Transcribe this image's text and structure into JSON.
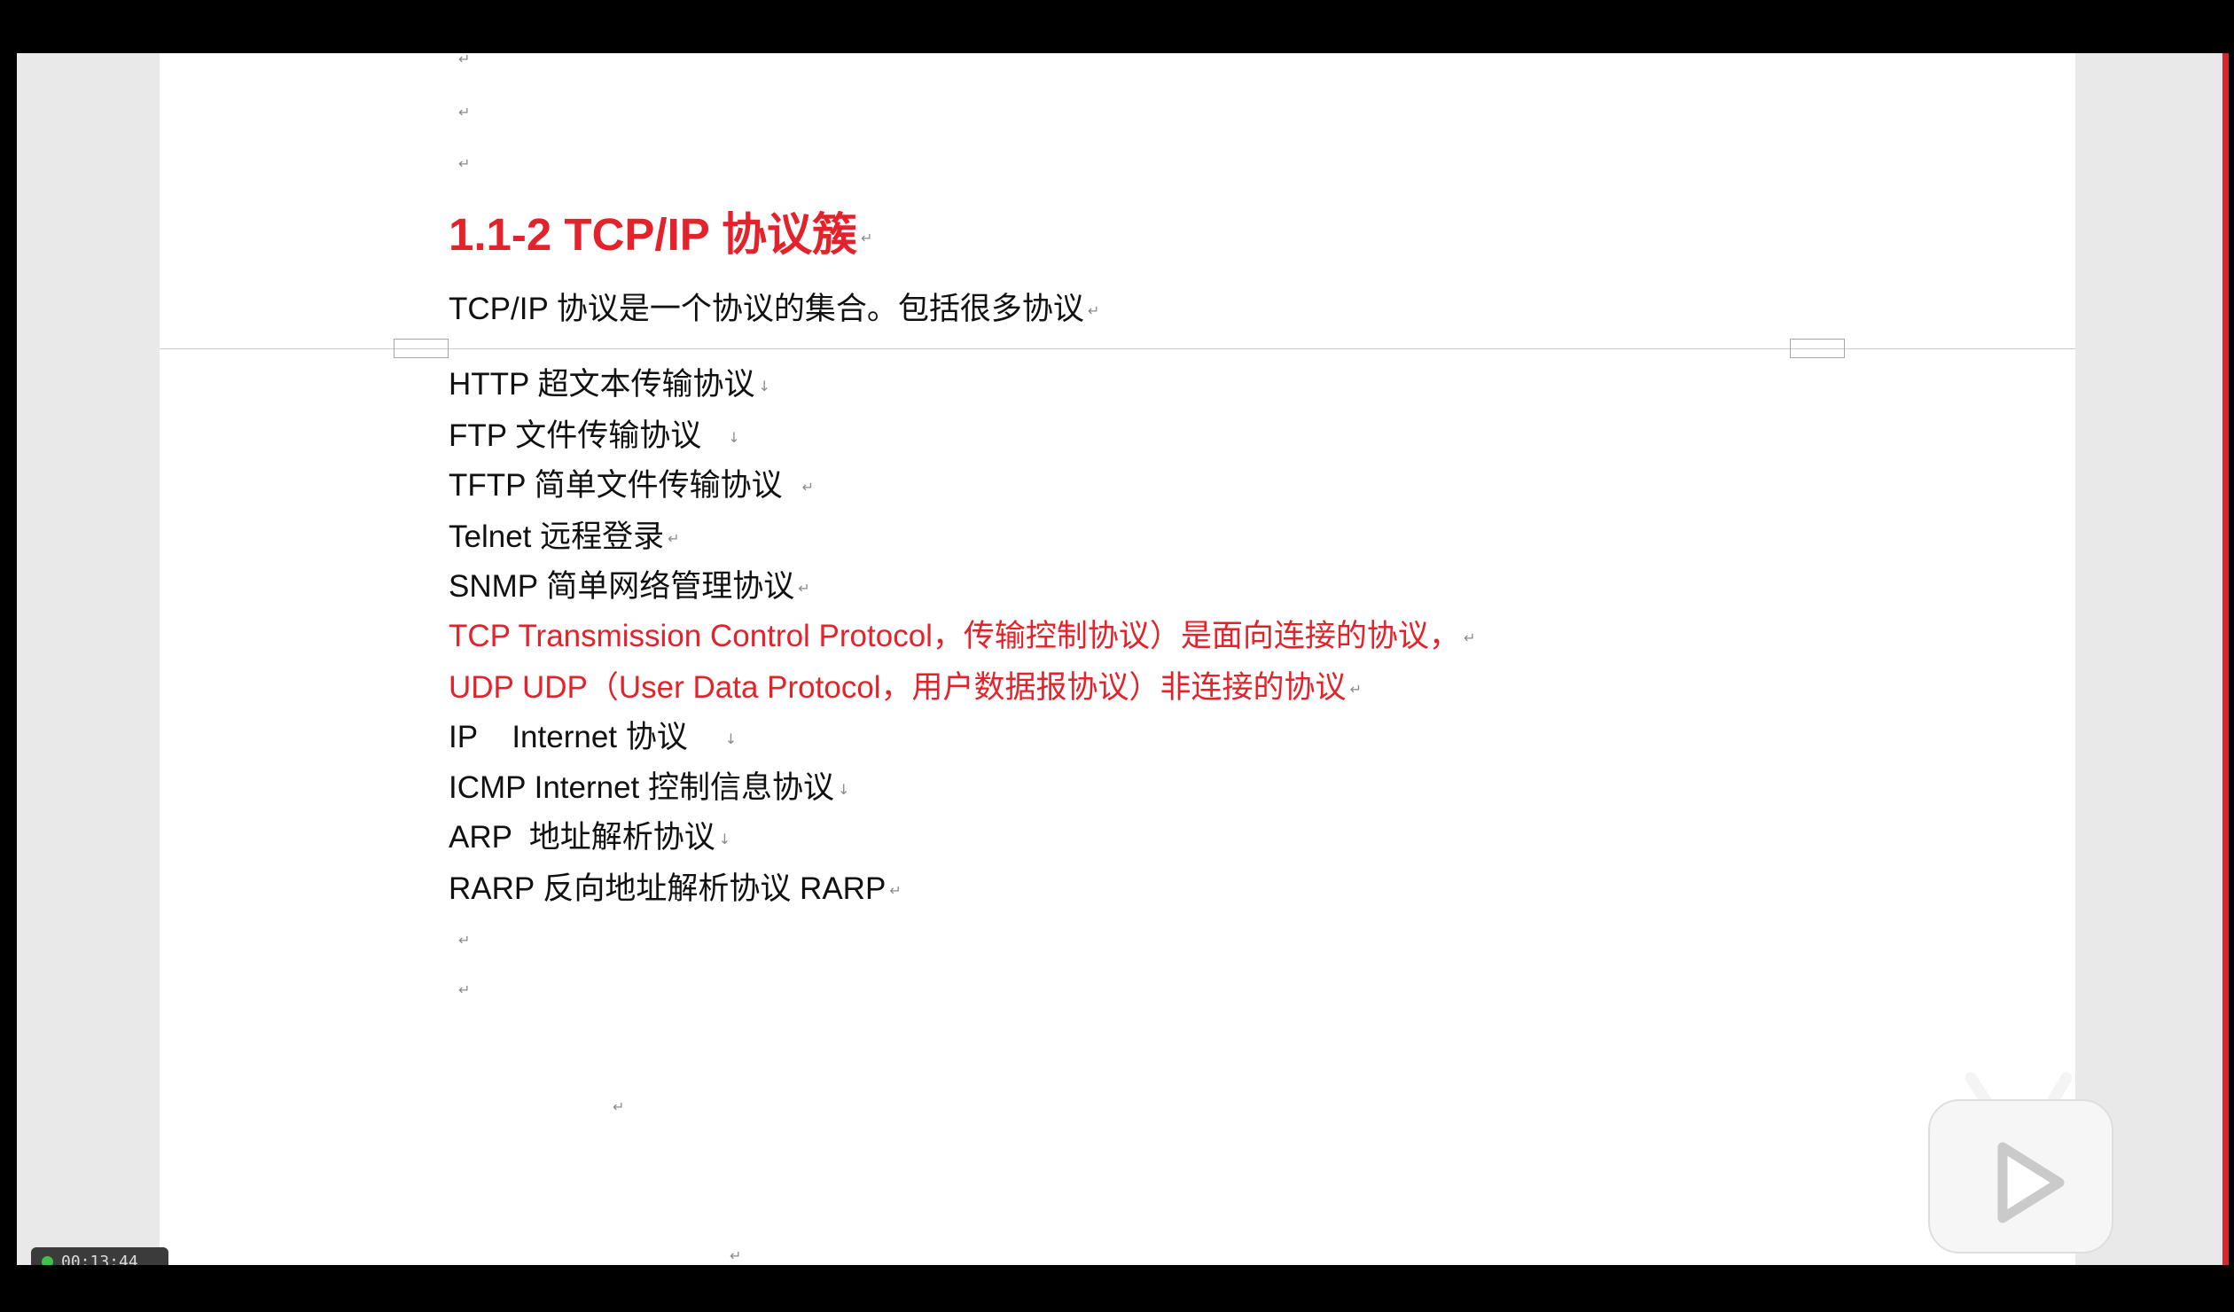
{
  "document": {
    "heading": "1.1-2 TCP/IP 协议簇",
    "heading_mark": "↵",
    "intro": "TCP/IP 协议是一个协议的集合。包括很多协议",
    "intro_mark": "↵",
    "paragraph_mark": "↵",
    "protocols": [
      {
        "text": "HTTP 超文本传输协议",
        "mark": "↓"
      },
      {
        "text": "FTP 文件传输协议",
        "mark": "↓"
      },
      {
        "text": "TFTP 简单文件传输协议",
        "mark": "↵"
      },
      {
        "text": "Telnet 远程登录",
        "mark": "↵"
      },
      {
        "text": "SNMP 简单网络管理协议",
        "mark": "↵"
      },
      {
        "text": "TCP Transmission Control Protocol，传输控制协议）是面向连接的协议，",
        "mark": "↵"
      },
      {
        "text": "UDP UDP（User Data Protocol，用户数据报协议）非连接的协议",
        "mark": "↵"
      },
      {
        "text": "IP    Internet 协议",
        "mark": "↓"
      },
      {
        "text": "ICMP Internet 控制信息协议",
        "mark": "↓"
      },
      {
        "text": "ARP  地址解析协议",
        "mark": "↓"
      },
      {
        "text": "RARP 反向地址解析协议 RARP",
        "mark": "↵"
      }
    ]
  },
  "overlay": {
    "timer": "00:13:44"
  },
  "colors": {
    "accent_red": "#e2232b",
    "text": "#111111",
    "timer_dot": "#3ec24b"
  },
  "icons": {
    "watermark": "tv-play-logo-icon",
    "paragraph": "return-mark-icon",
    "line_break": "down-arrow-mark-icon"
  }
}
